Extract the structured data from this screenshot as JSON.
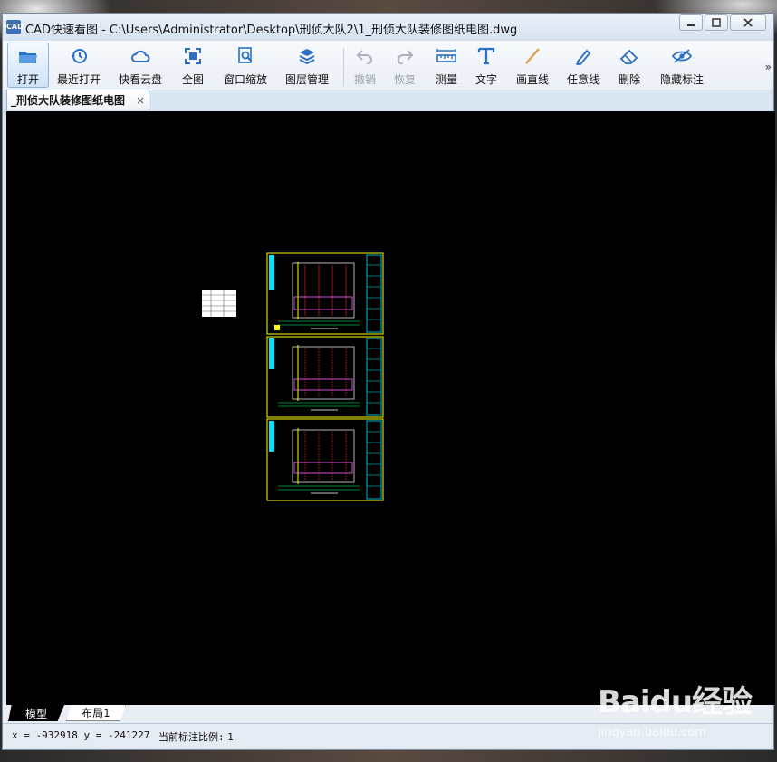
{
  "window": {
    "app_icon_text": "CAD",
    "title": "CAD快速看图 - C:\\Users\\Administrator\\Desktop\\刑侦大队2\\1_刑侦大队装修图纸电图.dwg"
  },
  "toolbar": {
    "open": "打开",
    "recent": "最近打开",
    "cloud": "快看云盘",
    "fit": "全图",
    "zoom_window": "窗口缩放",
    "layers": "图层管理",
    "undo": "撤销",
    "redo": "恢复",
    "measure": "测量",
    "text": "文字",
    "line": "画直线",
    "freehand": "任意线",
    "erase": "删除",
    "hide_marks": "隐藏标注",
    "more": "»"
  },
  "doc_tab": {
    "label": "_刑侦大队装修图纸电图",
    "close": "×"
  },
  "layout_tabs": {
    "model": "模型",
    "layout1": "布局1"
  },
  "status": {
    "coords": "x = -932918 y = -241227",
    "scale_label": "当前标注比例:",
    "scale_value": "1"
  },
  "watermark": {
    "brand": "Baidu经验",
    "url": "jingyan.baidu.com"
  },
  "colors": {
    "canvas": "#000000",
    "frame": "#ffff00",
    "cyan": "#00e5ff",
    "red": "#ff2a2a",
    "accent": "#3b6fb6"
  }
}
